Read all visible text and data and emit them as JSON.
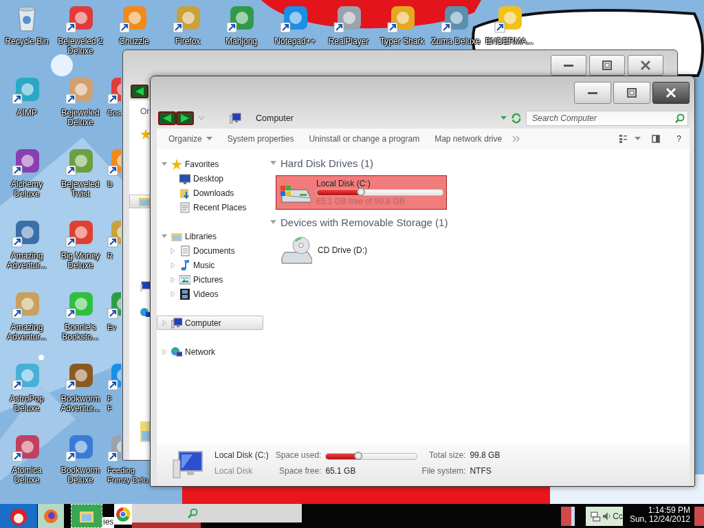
{
  "desktop": {
    "top_row": [
      {
        "label": "Recycle Bin",
        "kind": "bin",
        "shortcut": false
      },
      {
        "label": "Bejeweled 2 Deluxe",
        "kind": "app",
        "shortcut": true
      },
      {
        "label": "Chuzzle",
        "kind": "app",
        "shortcut": true
      },
      {
        "label": "Firefox",
        "kind": "app",
        "shortcut": true
      },
      {
        "label": "Mahjong",
        "kind": "app",
        "shortcut": true
      },
      {
        "label": "Notepad++",
        "kind": "app",
        "shortcut": true
      },
      {
        "label": "RealPlayer",
        "kind": "app",
        "shortcut": true
      },
      {
        "label": "Typer Shark",
        "kind": "app",
        "shortcut": true
      },
      {
        "label": "Zuma Deluxe",
        "kind": "app",
        "shortcut": true
      },
      {
        "label": "ENDERMA...",
        "kind": "app",
        "shortcut": true
      }
    ],
    "columns": [
      [
        {
          "label": "AIMP",
          "kind": "app",
          "shortcut": true
        },
        {
          "label": "Alchemy Deluxe",
          "kind": "app",
          "shortcut": true
        },
        {
          "label": "Amazing Adventur...",
          "kind": "app",
          "shortcut": true
        },
        {
          "label": "Amazing Adventur...",
          "kind": "app",
          "shortcut": true
        },
        {
          "label": "AstroPop Deluxe",
          "kind": "app",
          "shortcut": true
        },
        {
          "label": "Atomica Deluxe",
          "kind": "app",
          "shortcut": true
        }
      ],
      [
        {
          "label": "Bejeweled Deluxe",
          "kind": "app",
          "shortcut": true
        },
        {
          "label": "Bejeweled Twist",
          "kind": "app",
          "shortcut": true
        },
        {
          "label": "Big Money Deluxe",
          "kind": "app",
          "shortcut": true
        },
        {
          "label": "Bonnie's Booksto...",
          "kind": "app",
          "shortcut": true
        },
        {
          "label": "Bookworm Adventur...",
          "kind": "app",
          "shortcut": true
        },
        {
          "label": "Bookworm Deluxe",
          "kind": "app",
          "shortcut": true
        }
      ],
      [
        {
          "label": "Cos",
          "kind": "app",
          "shortcut": true
        },
        {
          "label": "D",
          "kind": "app",
          "shortcut": true
        },
        {
          "label": "R",
          "kind": "app",
          "shortcut": true
        },
        {
          "label": "Ev",
          "kind": "app",
          "shortcut": true
        },
        {
          "label": "F\nF",
          "kind": "app",
          "shortcut": true
        },
        {
          "label": "Feeding\nFrenzy Delu",
          "kind": "app",
          "shortcut": true
        }
      ]
    ]
  },
  "back_window": {
    "toolbar_item": "Or"
  },
  "explorer": {
    "address": {
      "location": "Computer"
    },
    "search": {
      "placeholder": "Search Computer"
    },
    "toolbar": {
      "items": [
        {
          "label": "Organize",
          "dropdown": true
        },
        {
          "label": "System properties",
          "dropdown": false
        },
        {
          "label": "Uninstall or change a program",
          "dropdown": false
        },
        {
          "label": "Map network drive",
          "dropdown": false
        }
      ],
      "help": "?"
    },
    "navigation": {
      "groups": [
        {
          "label": "Favorites",
          "expanded": true,
          "selected": false,
          "children": [
            {
              "label": "Desktop",
              "selected": false
            },
            {
              "label": "Downloads",
              "selected": false
            },
            {
              "label": "Recent Places",
              "selected": false
            }
          ]
        },
        {
          "label": "Libraries",
          "expanded": true,
          "selected": false,
          "children": [
            {
              "label": "Documents",
              "expanded": false,
              "selected": false
            },
            {
              "label": "Music",
              "expanded": false,
              "selected": false
            },
            {
              "label": "Pictures",
              "expanded": false,
              "selected": false
            },
            {
              "label": "Videos",
              "expanded": false,
              "selected": false
            }
          ]
        },
        {
          "label": "Computer",
          "expanded": false,
          "selected": true
        },
        {
          "label": "Network",
          "expanded": false,
          "selected": false
        }
      ]
    },
    "content": {
      "groups": [
        {
          "title": "Hard Disk Drives (1)",
          "expanded": true,
          "items": [
            {
              "kind": "disk",
              "name": "Local Disk (C:)",
              "selected": true,
              "level": 0.35,
              "free_text": "65.1 GB free of 99.8 GB"
            }
          ]
        },
        {
          "title": "Devices with Removable Storage (1)",
          "expanded": true,
          "items": [
            {
              "kind": "cd",
              "name": "CD Drive (D:)",
              "selected": false
            }
          ]
        }
      ]
    },
    "details": {
      "name": "Local Disk (C:)",
      "type": "Local Disk",
      "fields": [
        {
          "label": "Space used:",
          "kind": "bar",
          "level": 0.35
        },
        {
          "label": "Total size:",
          "kind": "text",
          "value": "99.8 GB"
        },
        {
          "label": "Space free:",
          "kind": "text",
          "value": "65.1 GB"
        },
        {
          "label": "File system:",
          "kind": "text",
          "value": "NTFS"
        }
      ]
    }
  },
  "taskbar": {
    "fragment": "ies",
    "tray_fragment": "Cc",
    "clock": {
      "time": "1:14:59 PM",
      "date": "Sun, 12/24/2012"
    }
  }
}
